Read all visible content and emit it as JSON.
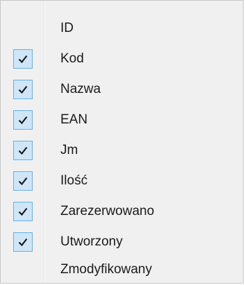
{
  "menu": {
    "items": [
      {
        "label": "ID",
        "checked": false
      },
      {
        "label": "Kod",
        "checked": true
      },
      {
        "label": "Nazwa",
        "checked": true
      },
      {
        "label": "EAN",
        "checked": true
      },
      {
        "label": "Jm",
        "checked": true
      },
      {
        "label": "Ilość",
        "checked": true
      },
      {
        "label": "Zarezerwowano",
        "checked": true
      },
      {
        "label": "Utworzony",
        "checked": true
      },
      {
        "label": "Zmodyfikowany",
        "checked": false
      }
    ]
  },
  "colors": {
    "check_fill": "#cfe6f8",
    "check_border": "#66aee4",
    "check_mark": "#1a1a1a"
  }
}
